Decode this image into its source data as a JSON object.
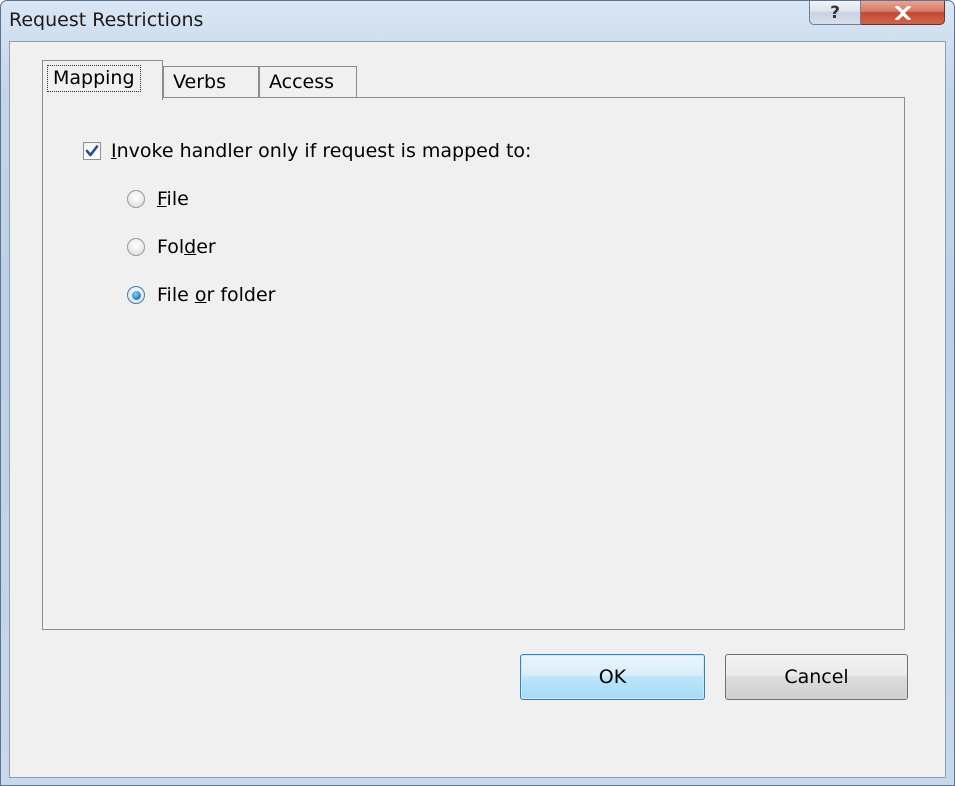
{
  "window": {
    "title": "Request Restrictions",
    "help_glyph": "?",
    "close_glyph": "close-icon"
  },
  "tabs": [
    {
      "label": "Mapping",
      "active": true
    },
    {
      "label": "Verbs",
      "active": false
    },
    {
      "label": "Access",
      "active": false
    }
  ],
  "mapping": {
    "invoke_checkbox": {
      "label_accel": "I",
      "label_rest": "nvoke handler only if request is mapped to:",
      "checked": true
    },
    "options": [
      {
        "pre": "",
        "accel": "F",
        "post": "ile",
        "checked": false
      },
      {
        "pre": "Fol",
        "accel": "d",
        "post": "er",
        "checked": false
      },
      {
        "pre": "File ",
        "accel": "o",
        "post": "r folder",
        "checked": true
      }
    ]
  },
  "buttons": {
    "ok": "OK",
    "cancel": "Cancel"
  },
  "colors": {
    "accent": "#3c7fb1",
    "close_red": "#c24a33",
    "dialog_bg": "#f0f0f0"
  }
}
